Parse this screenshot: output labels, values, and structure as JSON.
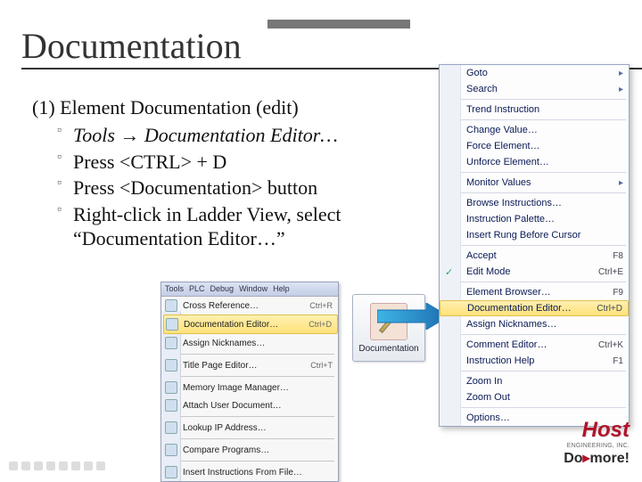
{
  "title": "Documentation",
  "subhead": "(1) Element Documentation (edit)",
  "bullets": [
    {
      "text_html": "Tools → Documentation Editor…",
      "italic": true
    },
    {
      "text_html": "Press <CTRL> + D"
    },
    {
      "text_html": "Press <Documentation> button"
    },
    {
      "text_html": "Right-click in Ladder View, select “Documentation Editor…”"
    }
  ],
  "tools_menu": {
    "menubar": [
      "Tools",
      "PLC",
      "Debug",
      "Window",
      "Help"
    ],
    "items": [
      {
        "label": "Cross Reference…",
        "shortcut": "Ctrl+R"
      },
      {
        "label": "Documentation Editor…",
        "shortcut": "Ctrl+D",
        "highlight": true
      },
      {
        "label": "Assign Nicknames…"
      },
      {
        "sep": true
      },
      {
        "label": "Title Page Editor…",
        "shortcut": "Ctrl+T"
      },
      {
        "sep": true
      },
      {
        "label": "Memory Image Manager…"
      },
      {
        "label": "Attach User Document…"
      },
      {
        "sep": true
      },
      {
        "label": "Lookup IP Address…"
      },
      {
        "sep": true
      },
      {
        "label": "Compare Programs…"
      },
      {
        "sep": true
      },
      {
        "label": "Insert Instructions From File…"
      }
    ]
  },
  "doc_button": {
    "label": "Documentation"
  },
  "context_menu": {
    "items": [
      {
        "label": "Goto",
        "sub": true
      },
      {
        "label": "Search",
        "sub": true
      },
      {
        "sep": true
      },
      {
        "label": "Trend Instruction"
      },
      {
        "sep": true
      },
      {
        "label": "Change Value…"
      },
      {
        "label": "Force Element…"
      },
      {
        "label": "Unforce Element…"
      },
      {
        "sep": true
      },
      {
        "label": "Monitor Values",
        "sub": true
      },
      {
        "sep": true
      },
      {
        "label": "Browse Instructions…"
      },
      {
        "label": "Instruction Palette…"
      },
      {
        "label": "Insert Rung Before Cursor"
      },
      {
        "sep": true
      },
      {
        "label": "Accept",
        "shortcut": "F8"
      },
      {
        "label": "Edit Mode",
        "shortcut": "Ctrl+E",
        "checked": true
      },
      {
        "sep": true
      },
      {
        "label": "Element Browser…",
        "shortcut": "F9"
      },
      {
        "label": "Documentation Editor…",
        "shortcut": "Ctrl+D",
        "highlight": true
      },
      {
        "label": "Assign Nicknames…"
      },
      {
        "sep": true
      },
      {
        "label": "Comment Editor…",
        "shortcut": "Ctrl+K"
      },
      {
        "label": "Instruction Help",
        "shortcut": "F1"
      },
      {
        "sep": true
      },
      {
        "label": "Zoom In"
      },
      {
        "label": "Zoom Out"
      },
      {
        "sep": true
      },
      {
        "label": "Options…"
      }
    ]
  },
  "logo": {
    "line1": "Host",
    "line2_a": "Do",
    "line2_b": "more!",
    "line3": "ENGINEERING, INC."
  }
}
